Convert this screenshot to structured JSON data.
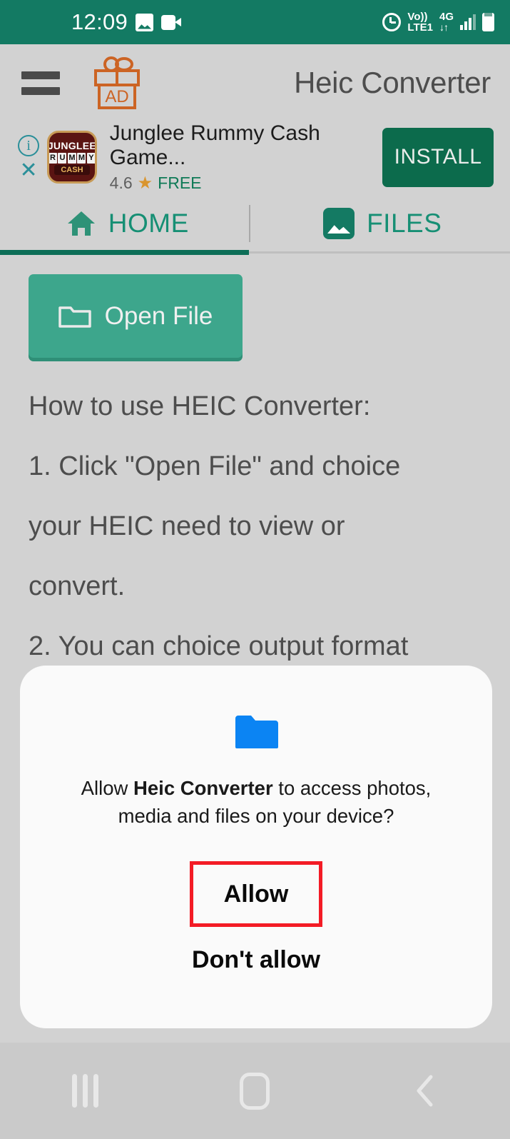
{
  "status_bar": {
    "time": "12:09",
    "icons_left": [
      "photo-icon",
      "video-camera-icon"
    ],
    "alarm_icon": "alarm-icon",
    "volte_line1": "Vo))",
    "volte_line2": "LTE1",
    "network_type": "4G",
    "data_arrows": "↓↑",
    "signal_icon": "signal-bars-icon",
    "battery_icon": "battery-icon",
    "background_color": "#137a63"
  },
  "app_bar": {
    "menu_icon": "hamburger-menu-icon",
    "ad_gift_label": "AD",
    "title": "Heic Converter"
  },
  "ad_banner": {
    "info_icon": "info-icon",
    "close_icon": "close-icon",
    "app_icon": {
      "line1": "JUNGLEE",
      "line2": [
        "R",
        "U",
        "M",
        "M",
        "Y"
      ],
      "line3": "CASH"
    },
    "title": "Junglee Rummy Cash Game...",
    "rating": "4.6",
    "star_icon": "star-icon",
    "price": "FREE",
    "install_label": "INSTALL",
    "install_color": "#0c6b4c"
  },
  "tabs": {
    "items": [
      {
        "label": "HOME",
        "icon": "home-icon",
        "active": true
      },
      {
        "label": "FILES",
        "icon": "image-icon",
        "active": false
      }
    ],
    "accent_color": "#168f74",
    "indicator_color": "#0d6e57"
  },
  "main": {
    "open_file_button": {
      "label": "Open File",
      "icon": "folder-icon",
      "color": "#3da68c"
    },
    "instructions": [
      "How to use HEIC Converter:",
      "1. Click \"Open File\" and choice",
      "your HEIC need to view or",
      "convert.",
      "2. You can choice output format"
    ]
  },
  "permission_dialog": {
    "icon": "blue-folder-icon",
    "icon_color": "#0b84f3",
    "message_prefix": "Allow ",
    "message_app": "Heic Converter",
    "message_suffix": " to access photos, media and files on your device?",
    "allow_label": "Allow",
    "deny_label": "Don't allow",
    "highlight_color": "#f31b25"
  },
  "nav_bar": {
    "recents_icon": "recents-icon",
    "home_icon": "home-button-icon",
    "back_icon": "back-icon"
  }
}
